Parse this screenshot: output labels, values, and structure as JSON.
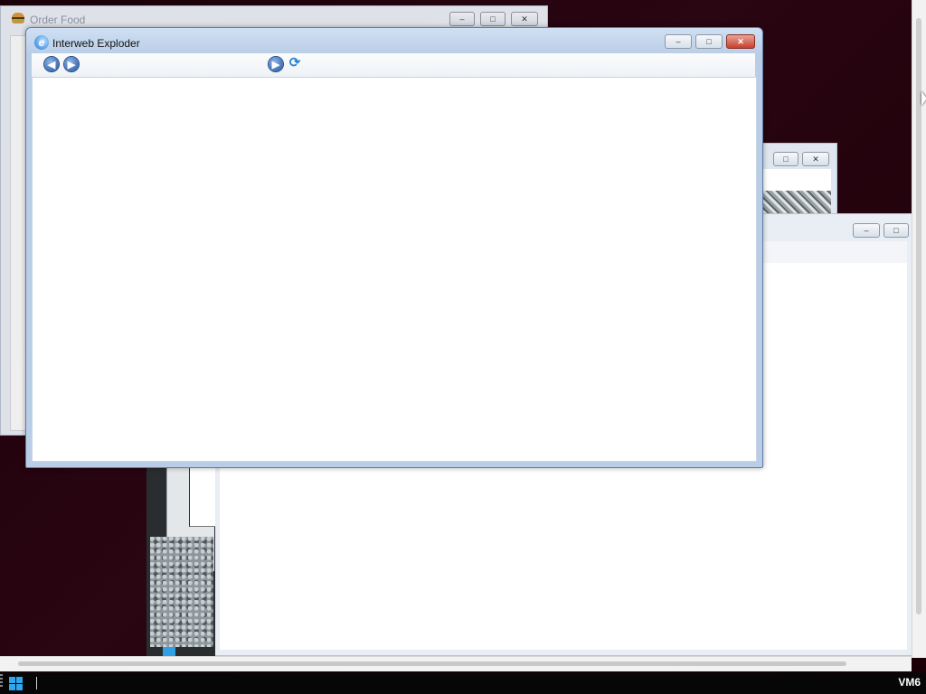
{
  "order_food": {
    "title": "Order Food",
    "icon": "burger-icon",
    "buttons": {
      "minimize": "–",
      "maximize": "□",
      "close": "✕"
    }
  },
  "image_window": {
    "buttons": {
      "maximize": "□",
      "close": "✕"
    }
  },
  "big_window": {
    "buttons": {
      "minimize": "–",
      "maximize": "□"
    }
  },
  "browser": {
    "title": "Interweb Exploder",
    "icon": "browser-logo-icon",
    "icon_glyph": "e",
    "address_value": "",
    "nav": {
      "back_glyph": "◀",
      "forward_glyph": "▶",
      "go_glyph": "▶",
      "refresh_glyph": "⟳"
    },
    "buttons": {
      "minimize": "–",
      "maximize": "□",
      "close": "✕"
    },
    "accent": "#1d74d9"
  },
  "taskbar": {
    "vm_label": "VM6",
    "start_icon": "windows-logo-icon"
  }
}
